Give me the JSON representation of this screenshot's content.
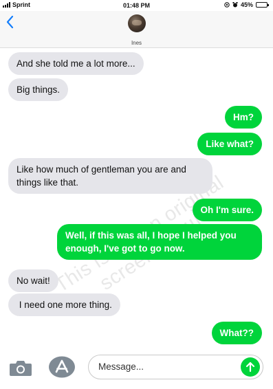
{
  "status_bar": {
    "carrier": "Sprint",
    "time": "01:48 PM",
    "battery": "45%",
    "battery_level": 0.45
  },
  "header": {
    "back_icon": "chevron-left-icon",
    "contact_name": "Ines"
  },
  "watermark": "This is not an original screenshot!!!",
  "messages": [
    {
      "direction": "incoming",
      "text": "And she told me a lot more..."
    },
    {
      "direction": "incoming",
      "text": "Big things."
    },
    {
      "direction": "outgoing",
      "text": "Hm?"
    },
    {
      "direction": "outgoing",
      "text": "Like what?"
    },
    {
      "direction": "incoming",
      "text": "Like how much of gentleman you are and things like that."
    },
    {
      "direction": "outgoing",
      "text": "Oh I'm sure."
    },
    {
      "direction": "outgoing",
      "text": "Well, if this was all, I hope I helped you enough, I've got to go now."
    },
    {
      "direction": "incoming",
      "text": "No wait!"
    },
    {
      "direction": "incoming",
      "text": " I need one more thing."
    },
    {
      "direction": "outgoing",
      "text": "What??"
    }
  ],
  "input_bar": {
    "camera_icon": "camera-icon",
    "apps_icon": "app-store-icon",
    "placeholder": "Message...",
    "send_icon": "arrow-up-icon"
  },
  "colors": {
    "outgoing_bubble": "#00d43b",
    "incoming_bubble": "#e5e5ea",
    "accent": "#147efb"
  }
}
